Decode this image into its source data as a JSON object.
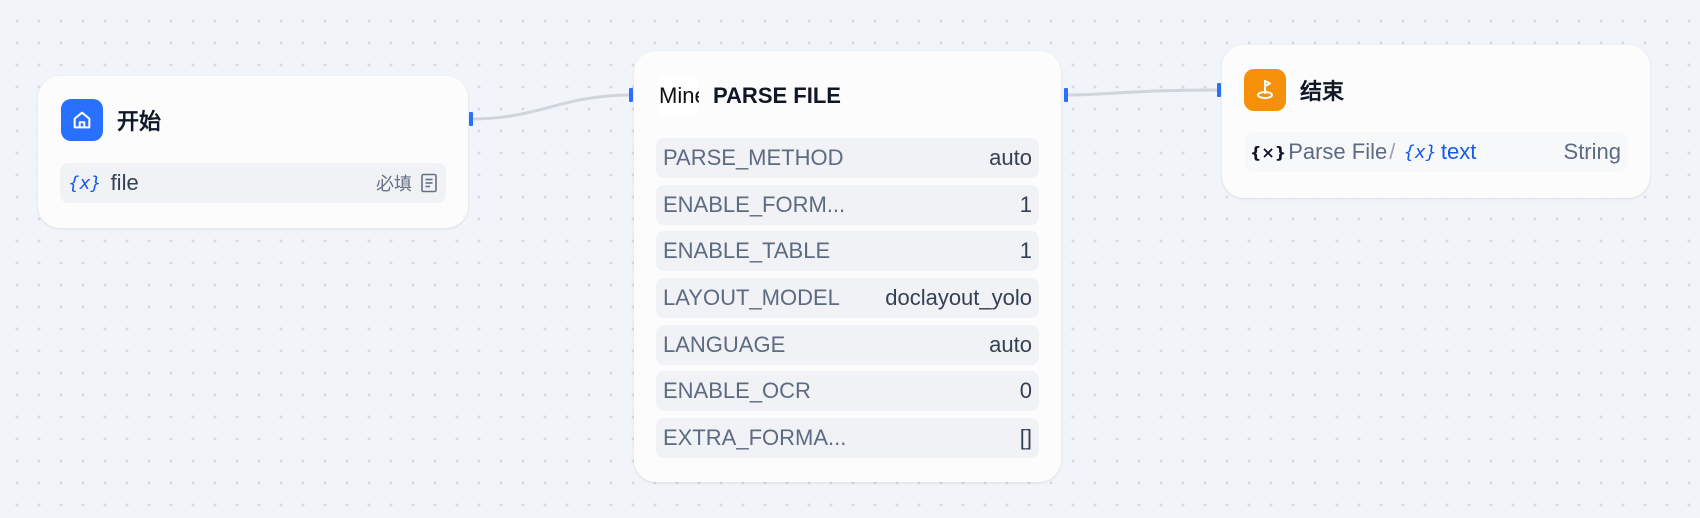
{
  "start_node": {
    "title": "开始",
    "icon": "home-icon",
    "icon_color": "#2970ff",
    "variable": {
      "glyph": "{x}",
      "name": "file",
      "required_label": "必填",
      "type_icon": "document-icon"
    }
  },
  "parse_node": {
    "title": "PARSE FILE",
    "logo_text": "Mineru",
    "params": [
      {
        "key": "PARSE_METHOD",
        "value": "auto"
      },
      {
        "key": "ENABLE_FORM...",
        "value": "1"
      },
      {
        "key": "ENABLE_TABLE",
        "value": "1"
      },
      {
        "key": "LAYOUT_MODEL",
        "value": "doclayout_yolo"
      },
      {
        "key": "LANGUAGE",
        "value": "auto"
      },
      {
        "key": "ENABLE_OCR",
        "value": "0"
      },
      {
        "key": "EXTRA_FORMA...",
        "value": "[]"
      }
    ]
  },
  "end_node": {
    "title": "结束",
    "icon": "end-flag-icon",
    "icon_color": "#f79009",
    "output": {
      "source_glyph": "{×}",
      "source_name": "Parse File",
      "separator": "/",
      "var_glyph": "{x}",
      "var_name": "text",
      "type": "String"
    }
  },
  "colors": {
    "handle": "#2970ff",
    "edge": "#d0d5dd",
    "variable": "#155aef"
  }
}
